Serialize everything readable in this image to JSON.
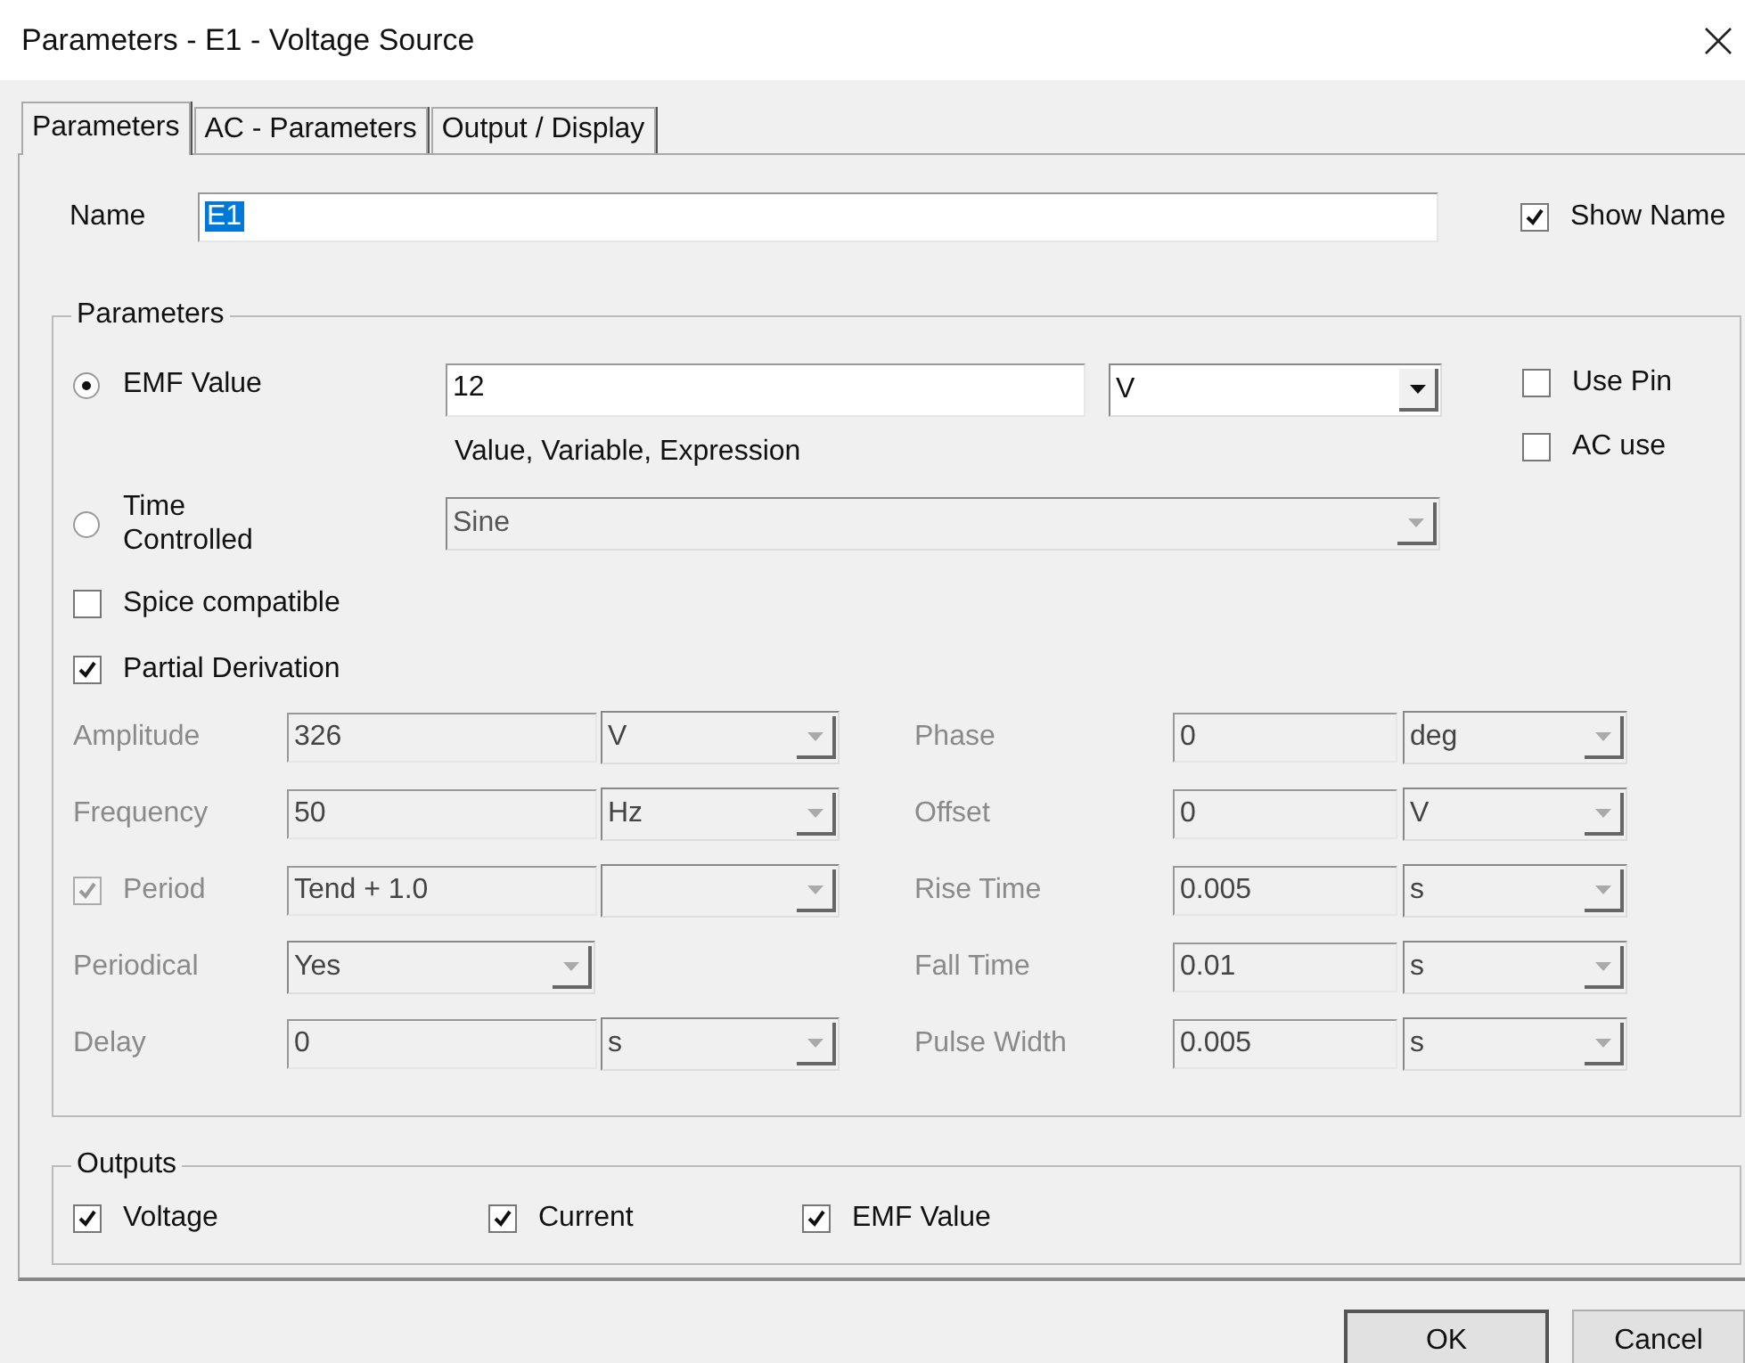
{
  "window": {
    "title": "Parameters - E1 - Voltage Source"
  },
  "tabs": [
    {
      "label": "Parameters",
      "selected": true
    },
    {
      "label": "AC - Parameters",
      "selected": false
    },
    {
      "label": "Output / Display",
      "selected": false
    }
  ],
  "name": {
    "label": "Name",
    "value": "E1",
    "value_selected": true,
    "show_name": {
      "label": "Show Name",
      "checked": true
    }
  },
  "parameters": {
    "title": "Parameters",
    "emf": {
      "label": "EMF Value",
      "selected": true,
      "value": "12",
      "unit": "V",
      "hint": "Value, Variable, Expression"
    },
    "time_controlled": {
      "label": "Time Controlled",
      "selected": false,
      "waveform": "Sine",
      "disabled": true
    },
    "side_options": [
      {
        "label": "Use Pin",
        "checked": false
      },
      {
        "label": "AC use",
        "checked": false
      }
    ],
    "options": [
      {
        "label": "Spice compatible",
        "checked": false
      },
      {
        "label": "Partial Derivation",
        "checked": true
      }
    ],
    "left_fields": [
      {
        "kind": "field",
        "label": "Amplitude",
        "value": "326",
        "unit": "V",
        "disabled": true
      },
      {
        "kind": "field",
        "label": "Frequency",
        "value": "50",
        "unit": "Hz",
        "disabled": true
      },
      {
        "kind": "check",
        "label": "Period",
        "checked": true,
        "value": "Tend + 1.0",
        "disabled": true
      },
      {
        "kind": "combo",
        "label": "Periodical",
        "value": "Yes",
        "disabled": true
      },
      {
        "kind": "field",
        "label": "Delay",
        "value": "0",
        "unit": "s",
        "disabled": true
      }
    ],
    "right_fields": [
      {
        "kind": "field",
        "label": "Phase",
        "value": "0",
        "unit": "deg",
        "disabled": true
      },
      {
        "kind": "field",
        "label": "Offset",
        "value": "0",
        "unit": "V",
        "disabled": true
      },
      {
        "kind": "field",
        "label": "Rise Time",
        "value": "0.005",
        "unit": "s",
        "disabled": true
      },
      {
        "kind": "field",
        "label": "Fall Time",
        "value": "0.01",
        "unit": "s",
        "disabled": true
      },
      {
        "kind": "field",
        "label": "Pulse Width",
        "value": "0.005",
        "unit": "s",
        "disabled": true
      }
    ]
  },
  "outputs": {
    "title": "Outputs",
    "items": [
      {
        "label": "Voltage",
        "checked": true
      },
      {
        "label": "Current",
        "checked": true
      },
      {
        "label": "EMF Value",
        "checked": true
      }
    ]
  },
  "buttons": [
    {
      "label": "OK",
      "default": true
    },
    {
      "label": "Cancel",
      "default": false
    }
  ]
}
